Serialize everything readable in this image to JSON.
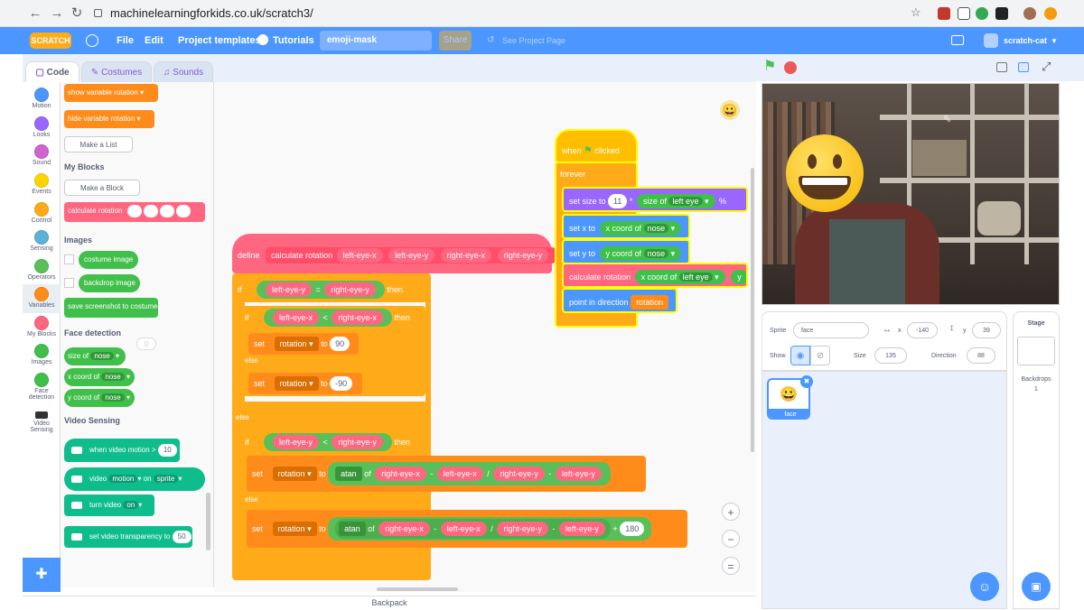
{
  "browser": {
    "url": "machinelearningforkids.co.uk/scratch3/"
  },
  "menu": {
    "logo": "SCRATCH",
    "file": "File",
    "edit": "Edit",
    "templates": "Project templates",
    "tutorials": "Tutorials",
    "project_title": "emoji-mask",
    "share": "Share",
    "see_project": "See Project Page",
    "user": "scratch-cat"
  },
  "tabs": {
    "code": "Code",
    "costumes": "Costumes",
    "sounds": "Sounds"
  },
  "categories": [
    {
      "label": "Motion",
      "color": "#4c97ff"
    },
    {
      "label": "Looks",
      "color": "#9966ff"
    },
    {
      "label": "Sound",
      "color": "#cf63cf"
    },
    {
      "label": "Events",
      "color": "#ffd500"
    },
    {
      "label": "Control",
      "color": "#ffab19"
    },
    {
      "label": "Sensing",
      "color": "#5cb1d6"
    },
    {
      "label": "Operators",
      "color": "#59c059"
    },
    {
      "label": "Variables",
      "color": "#ff8c1a"
    },
    {
      "label": "My Blocks",
      "color": "#ff6680"
    },
    {
      "label": "Images",
      "color": "#40bf4a"
    },
    {
      "label": "Face detection",
      "color": "#40bf4a"
    },
    {
      "label": "Video Sensing",
      "color": "#0fbd8c"
    }
  ],
  "palette": {
    "show_variable": "show variable",
    "hide_variable": "hide variable",
    "var_name": "rotation",
    "make_list": "Make a List",
    "my_blocks": "My Blocks",
    "make_block": "Make a Block",
    "calc_rotation": "calculate rotation",
    "images": "Images",
    "costume_image": "costume image",
    "backdrop_image": "backdrop image",
    "save_screenshot": "save screenshot to costume",
    "face_detection": "Face detection",
    "size_of": "size of",
    "x_coord_of": "x coord of",
    "y_coord_of": "y coord of",
    "nose": "nose",
    "zero": "0",
    "video_sensing": "Video Sensing",
    "when_video_motion": "when video motion >",
    "motion_val": "10",
    "video": "video",
    "motion": "motion",
    "on": "on",
    "sprite": "sprite",
    "turn_video": "turn video",
    "on_val": "on",
    "set_transparency": "set video transparency to",
    "transparency_val": "50"
  },
  "script_main": {
    "define": "define",
    "calc_rotation": "calculate rotation",
    "left_eye_x": "left-eye-x",
    "left_eye_y": "left-eye-y",
    "right_eye_x": "right-eye-x",
    "right_eye_y": "right-eye-y",
    "if": "if",
    "then": "then",
    "else": "else",
    "eq": "=",
    "lt": "<",
    "set": "set",
    "rotation": "rotation",
    "to": "to",
    "val_90": "90",
    "val_neg90": "-90",
    "atan": "atan",
    "of": "of",
    "minus": "-",
    "div": "/",
    "plus": "+",
    "val_180": "180"
  },
  "script_flag": {
    "when": "when",
    "clicked": "clicked",
    "forever": "forever",
    "set_size_to": "set size to",
    "size_val": "11",
    "star": "*",
    "size_of": "size of",
    "left_eye": "left eye",
    "percent": "%",
    "set_x_to": "set x to",
    "x_coord_of": "x coord of",
    "nose": "nose",
    "set_y_to": "set y to",
    "y_coord_of": "y coord of",
    "calc_rotation": "calculate rotation",
    "y_trunc": "y",
    "point_dir": "point in direction",
    "rotation": "rotation"
  },
  "backpack": "Backpack",
  "sprite_info": {
    "sprite_label": "Sprite",
    "sprite_name": "face",
    "x_label": "x",
    "x_val": "-140",
    "y_label": "y",
    "y_val": "39",
    "show_label": "Show",
    "size_label": "Size",
    "size_val": "135",
    "direction_label": "Direction",
    "direction_val": "88"
  },
  "sprite_thumb": "face",
  "stage_pane": {
    "title": "Stage",
    "backdrops": "Backdrops",
    "backdrops_count": "1"
  },
  "colors": {
    "motion": "#4c97ff",
    "looks": "#9966ff",
    "control": "#ffab19",
    "variables": "#ff8c1a",
    "myblocks": "#ff6680",
    "operators": "#59c059",
    "facedetect": "#40bf4a",
    "video": "#0fbd8c"
  }
}
